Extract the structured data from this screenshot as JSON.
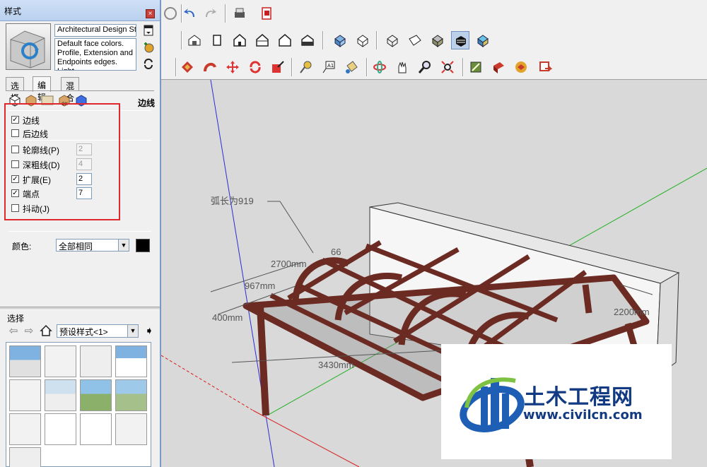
{
  "styles_panel": {
    "title": "样式",
    "close_label": "×",
    "style_name": "Architectural Design Style",
    "style_description": "Default face colors. Profile, Extension and Endpoints edges. Light",
    "tabs": [
      {
        "label": "选择"
      },
      {
        "label": "编辑"
      },
      {
        "label": "混合"
      }
    ],
    "active_tab": "编辑",
    "edit_section_label": "边线",
    "edge_settings": {
      "edges": {
        "label": "边线",
        "checked": true
      },
      "back_edges": {
        "label": "后边线",
        "checked": false
      },
      "profiles": {
        "label": "轮廓线(P)",
        "checked": false,
        "value": "2"
      },
      "depth_cue": {
        "label": "深粗线(D)",
        "checked": false,
        "value": "4"
      },
      "extension": {
        "label": "扩展(E)",
        "checked": true,
        "value": "2"
      },
      "endpoints": {
        "label": "端点",
        "checked": true,
        "value": "7"
      },
      "jitter": {
        "label": "抖动(J)",
        "checked": false
      }
    },
    "color": {
      "label": "颜色:",
      "selected": "全部相同",
      "swatch": "#000000"
    },
    "select_section": {
      "header": "选择",
      "collection": "预设样式<1>"
    }
  },
  "canvas_labels": {
    "arc_length": "弧长为919",
    "dim_2700": "2700mm",
    "dim_66": "66",
    "dim_967": "967mm",
    "dim_400": "400mm",
    "dim_3430": "3430mm",
    "dim_right": "2200mm"
  },
  "watermark": {
    "title": "土木工程网",
    "url": "www.civilcn.com"
  },
  "colors": {
    "highlight": "#e0272b",
    "frame": "#6b2a22",
    "wall": "#f4f4f4",
    "background": "#d9d9d9"
  },
  "toolbar_icons": {
    "row1": [
      "select-icon",
      "undo-icon",
      "redo-icon",
      "print-icon",
      "model-info-icon"
    ],
    "row2": [
      "iso-view-icon",
      "top-view-icon",
      "front-view-icon",
      "right-view-icon",
      "back-view-icon",
      "left-view-icon",
      "xray-icon",
      "back-edges-icon",
      "wireframe-icon",
      "hidden-line-icon",
      "shaded-icon",
      "shaded-textures-icon",
      "monochrome-icon"
    ],
    "row3": [
      "push-pull-icon",
      "follow-me-icon",
      "move-icon",
      "rotate-icon",
      "scale-icon",
      "tape-measure-icon",
      "text-icon",
      "paint-bucket-icon",
      "orbit-icon",
      "pan-icon",
      "zoom-icon",
      "zoom-extents-icon",
      "get-models-icon",
      "share-model-icon",
      "3d-warehouse-icon",
      "send-to-layout-icon"
    ]
  }
}
